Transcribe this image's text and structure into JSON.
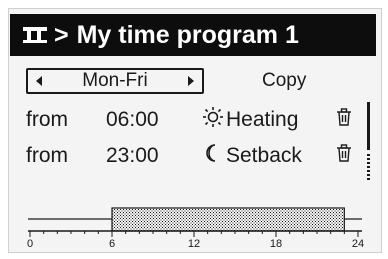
{
  "header": {
    "menu_icon": "menu-glyph-icon",
    "separator": ">",
    "title": "My time program 1"
  },
  "selector": {
    "day_value": "Mon-Fri",
    "copy_label": "Copy"
  },
  "program_rows": [
    {
      "from_label": "from",
      "time": "06:00",
      "mode_icon": "sun-icon",
      "mode": "Heating",
      "delete_icon": "trash-icon"
    },
    {
      "from_label": "from",
      "time": "23:00",
      "mode_icon": "moon-icon",
      "mode": "Setback",
      "delete_icon": "trash-icon"
    }
  ],
  "timeline": {
    "ticks": [
      "0",
      "6",
      "12",
      "18",
      "24"
    ],
    "heating_from_hour": 6,
    "heating_to_hour": 23,
    "max_hour": 24
  },
  "colors": {
    "foreground": "#1a1a1a",
    "background": "#f4f4f4",
    "header_bg": "#0d0d0d"
  }
}
